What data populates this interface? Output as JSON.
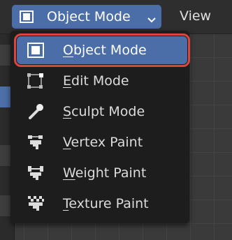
{
  "header": {
    "mode_button_label": "Object Mode",
    "view_menu_label": "View"
  },
  "menu": {
    "items": [
      {
        "first": "O",
        "rest": "bject Mode",
        "icon": "object-mode-icon",
        "selected": true
      },
      {
        "first": "E",
        "rest": "dit Mode",
        "icon": "edit-mode-icon",
        "selected": false
      },
      {
        "first": "S",
        "rest": "culpt Mode",
        "icon": "sculpt-mode-icon",
        "selected": false
      },
      {
        "first": "V",
        "rest": "ertex Paint",
        "icon": "vertex-paint-icon",
        "selected": false
      },
      {
        "first": "W",
        "rest": "eight Paint",
        "icon": "weight-paint-icon",
        "selected": false
      },
      {
        "first": "T",
        "rest": "exture Paint",
        "icon": "texture-paint-icon",
        "selected": false
      }
    ]
  },
  "colors": {
    "accent": "#4b6ea8",
    "highlight_outline": "#d9463d",
    "menu_bg": "#1d1d1d",
    "header_bg": "#2e2e2e"
  }
}
